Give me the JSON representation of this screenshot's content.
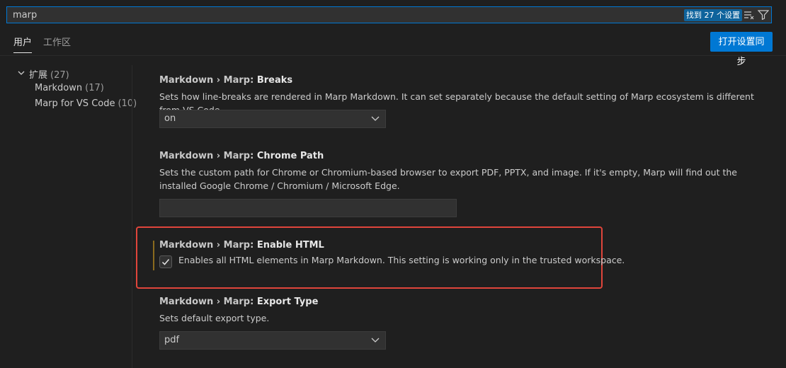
{
  "search": {
    "value": "marp",
    "results": "找到 27 个设置"
  },
  "tabs": [
    {
      "label": "用户"
    },
    {
      "label": "工作区"
    }
  ],
  "sync_button": "打开设置同步",
  "toc": {
    "root": {
      "label": "扩展",
      "count": "(27)"
    },
    "children": [
      {
        "label": "Markdown",
        "count": "(17)"
      },
      {
        "label": "Marp for VS Code",
        "count": "(10)"
      }
    ]
  },
  "settings": [
    {
      "category": "Markdown › Marp: ",
      "name": "Breaks",
      "description": "Sets how line-breaks are rendered in Marp Markdown. It can set separately because the default setting of Marp ecosystem is different from VS Code.",
      "value": "on"
    },
    {
      "category": "Markdown › Marp: ",
      "name": "Chrome Path",
      "description": "Sets the custom path for Chrome or Chromium-based browser to export PDF, PPTX, and image. If it's empty, Marp will find out the installed Google Chrome / Chromium / Microsoft Edge.",
      "value": ""
    },
    {
      "category": "Markdown › Marp: ",
      "name": "Enable HTML",
      "description": "Enables all HTML elements in Marp Markdown. This setting is working only in the trusted workspace.",
      "checked": true
    },
    {
      "category": "Markdown › Marp: ",
      "name": "Export Type",
      "description": "Sets default export type.",
      "value": "pdf"
    }
  ],
  "colors": {
    "accent": "#0078d4",
    "highlight": "#e0453b",
    "background": "#1f1f1f"
  }
}
